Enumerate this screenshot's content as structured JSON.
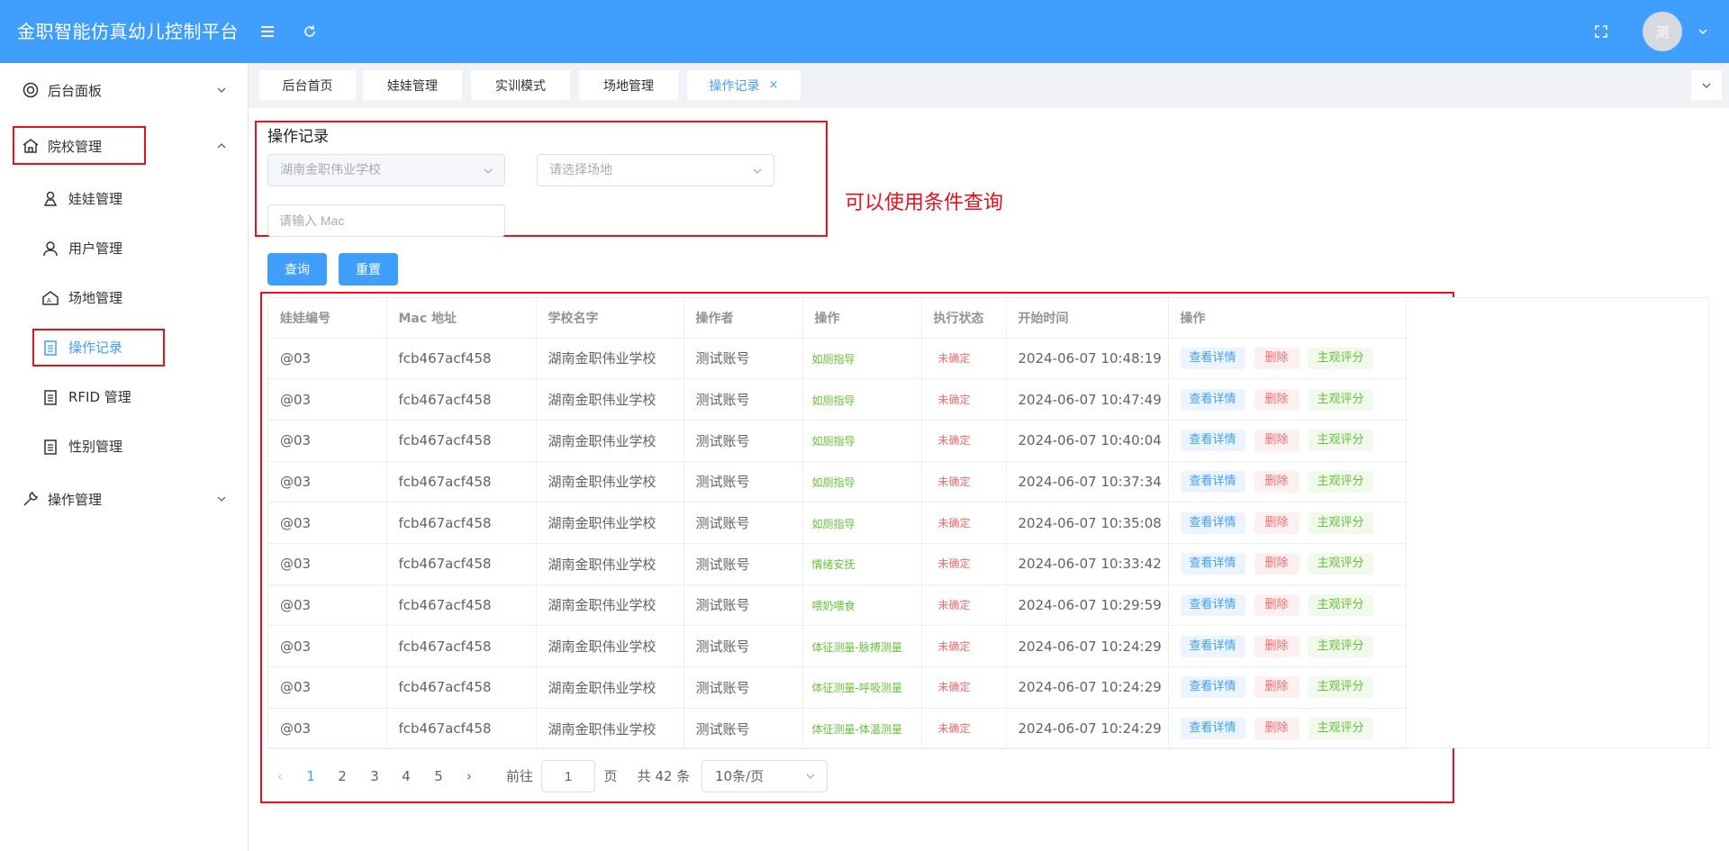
{
  "header": {
    "title": "金职智能仿真幼儿控制平台",
    "avatar_text": "测"
  },
  "sidebar": {
    "items": [
      {
        "label": "后台面板"
      },
      {
        "label": "院校管理"
      },
      {
        "label": "操作管理"
      }
    ],
    "sub_items": [
      {
        "label": "娃娃管理"
      },
      {
        "label": "用户管理"
      },
      {
        "label": "场地管理"
      },
      {
        "label": "操作记录"
      },
      {
        "label": "RFID 管理"
      },
      {
        "label": "性别管理"
      }
    ]
  },
  "tags": [
    {
      "label": "后台首页"
    },
    {
      "label": "娃娃管理"
    },
    {
      "label": "实训模式"
    },
    {
      "label": "场地管理"
    },
    {
      "label": "操作记录",
      "close": "×"
    }
  ],
  "filters": {
    "title": "操作记录",
    "school_select": "湖南金职伟业学校",
    "site_placeholder": "请选择场地",
    "mac_placeholder": "请输入 Mac",
    "query_label": "查询",
    "reset_label": "重置",
    "annotation": "可以使用条件查询"
  },
  "table": {
    "columns": [
      "娃娃编号",
      "Mac 地址",
      "学校名字",
      "操作者",
      "操作",
      "执行状态",
      "开始时间",
      "操作"
    ],
    "actions": {
      "view": "查看详情",
      "delete": "删除",
      "evaluate": "主观评分"
    },
    "rows": [
      {
        "doll": "@03",
        "mac": "fcb467acf458",
        "school": "湖南金职伟业学校",
        "operator": "测试账号",
        "op": "如厕指导",
        "status": "未确定",
        "time": "2024-06-07 10:48:19"
      },
      {
        "doll": "@03",
        "mac": "fcb467acf458",
        "school": "湖南金职伟业学校",
        "operator": "测试账号",
        "op": "如厕指导",
        "status": "未确定",
        "time": "2024-06-07 10:47:49"
      },
      {
        "doll": "@03",
        "mac": "fcb467acf458",
        "school": "湖南金职伟业学校",
        "operator": "测试账号",
        "op": "如厕指导",
        "status": "未确定",
        "time": "2024-06-07 10:40:04"
      },
      {
        "doll": "@03",
        "mac": "fcb467acf458",
        "school": "湖南金职伟业学校",
        "operator": "测试账号",
        "op": "如厕指导",
        "status": "未确定",
        "time": "2024-06-07 10:37:34"
      },
      {
        "doll": "@03",
        "mac": "fcb467acf458",
        "school": "湖南金职伟业学校",
        "operator": "测试账号",
        "op": "如厕指导",
        "status": "未确定",
        "time": "2024-06-07 10:35:08"
      },
      {
        "doll": "@03",
        "mac": "fcb467acf458",
        "school": "湖南金职伟业学校",
        "operator": "测试账号",
        "op": "情绪安抚",
        "status": "未确定",
        "time": "2024-06-07 10:33:42"
      },
      {
        "doll": "@03",
        "mac": "fcb467acf458",
        "school": "湖南金职伟业学校",
        "operator": "测试账号",
        "op": "喂奶喂食",
        "status": "未确定",
        "time": "2024-06-07 10:29:59"
      },
      {
        "doll": "@03",
        "mac": "fcb467acf458",
        "school": "湖南金职伟业学校",
        "operator": "测试账号",
        "op": "体征测量-脉搏测量",
        "status": "未确定",
        "time": "2024-06-07 10:24:29"
      },
      {
        "doll": "@03",
        "mac": "fcb467acf458",
        "school": "湖南金职伟业学校",
        "operator": "测试账号",
        "op": "体征测量-呼吸测量",
        "status": "未确定",
        "time": "2024-06-07 10:24:29"
      },
      {
        "doll": "@03",
        "mac": "fcb467acf458",
        "school": "湖南金职伟业学校",
        "operator": "测试账号",
        "op": "体征测量-体温测量",
        "status": "未确定",
        "time": "2024-06-07 10:24:29"
      }
    ]
  },
  "pagination": {
    "prev": "‹",
    "next": "›",
    "pages": [
      "1",
      "2",
      "3",
      "4",
      "5"
    ],
    "current": "1",
    "goto_label": "前往",
    "goto_value": "1",
    "page_unit": "页",
    "total": "共 42 条",
    "page_size": "10条/页"
  },
  "colors": {
    "primary": "#409EFF",
    "annotation_red": "#e8101c",
    "success": "#67c23a",
    "danger": "#f56c6c"
  }
}
